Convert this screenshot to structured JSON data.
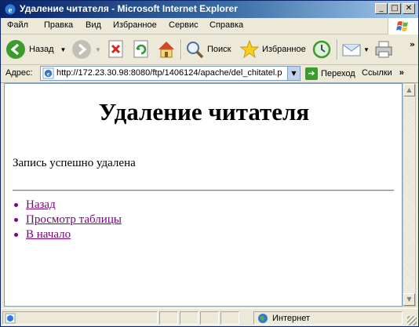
{
  "window": {
    "title": "Удаление читателя - Microsoft Internet Explorer",
    "minimize": "_",
    "maximize": "□",
    "close": "✕"
  },
  "menu": {
    "items": [
      "Файл",
      "Правка",
      "Вид",
      "Избранное",
      "Сервис",
      "Справка"
    ]
  },
  "toolbar": {
    "back_label": "Назад",
    "search_label": "Поиск",
    "favorites_label": "Избранное",
    "more": "»"
  },
  "address": {
    "label": "Адрес:",
    "url": "http://172.23.30.98:8080/ftp/1406124/apache/del_chitatel.p",
    "go_label": "Переход",
    "links_label": "Ссылки",
    "links_more": "»"
  },
  "page": {
    "heading": "Удаление читателя",
    "message": "Запись успешно удалена",
    "links": [
      "Назад",
      "Просмотр таблицы",
      "В начало"
    ],
    "link_color": "#800080"
  },
  "status": {
    "zone": "Интернет"
  },
  "colors": {
    "titlebar_start": "#0a246a",
    "titlebar_end": "#a6caf0",
    "chrome": "#ece9d8"
  }
}
